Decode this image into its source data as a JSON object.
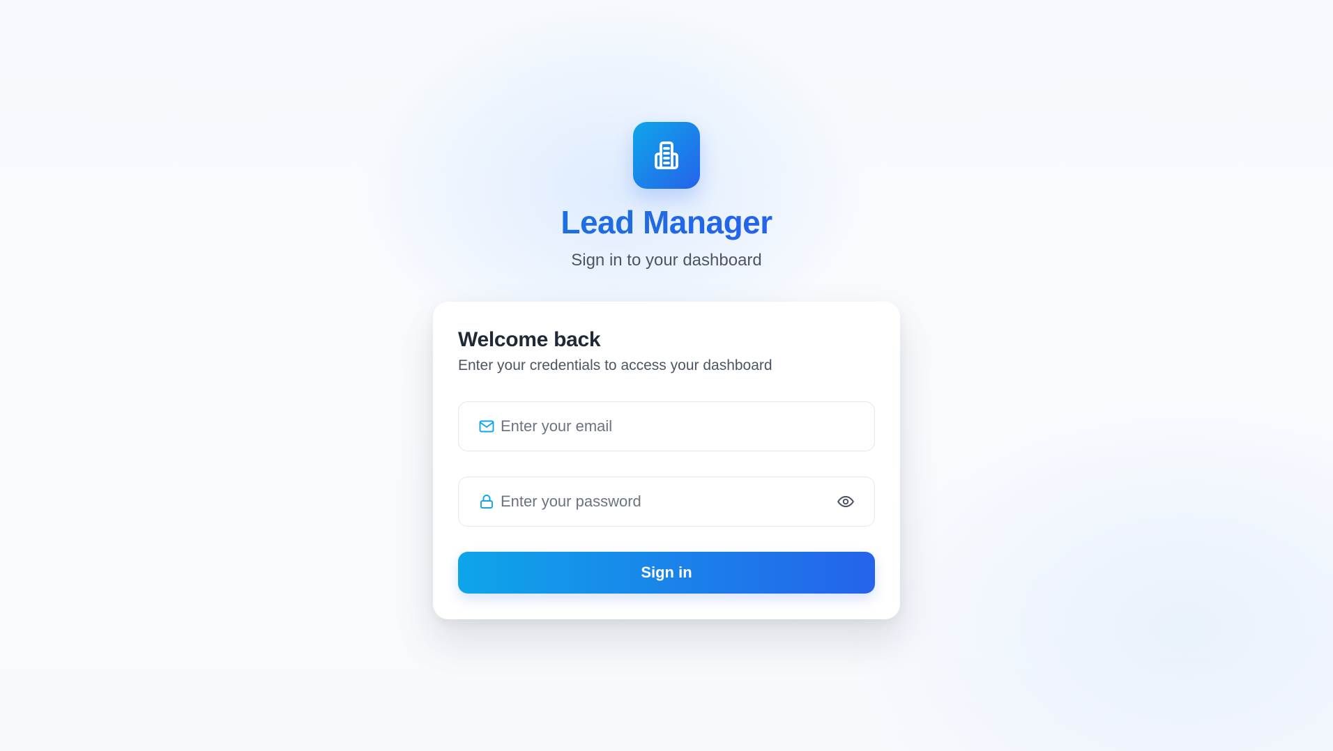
{
  "brand": {
    "logo_icon": "building-icon",
    "title": "Lead Manager",
    "subtitle": "Sign in to your dashboard",
    "accent_start": "#0ea5e9",
    "accent_end": "#2563eb"
  },
  "login_card": {
    "title": "Welcome back",
    "description": "Enter your credentials to access your dashboard",
    "email": {
      "icon": "mail-icon",
      "value": "",
      "placeholder": "Enter your email"
    },
    "password": {
      "icon": "lock-icon",
      "value": "",
      "placeholder": "Enter your password",
      "toggle_icon": "eye-icon"
    },
    "submit_label": "Sign in"
  }
}
